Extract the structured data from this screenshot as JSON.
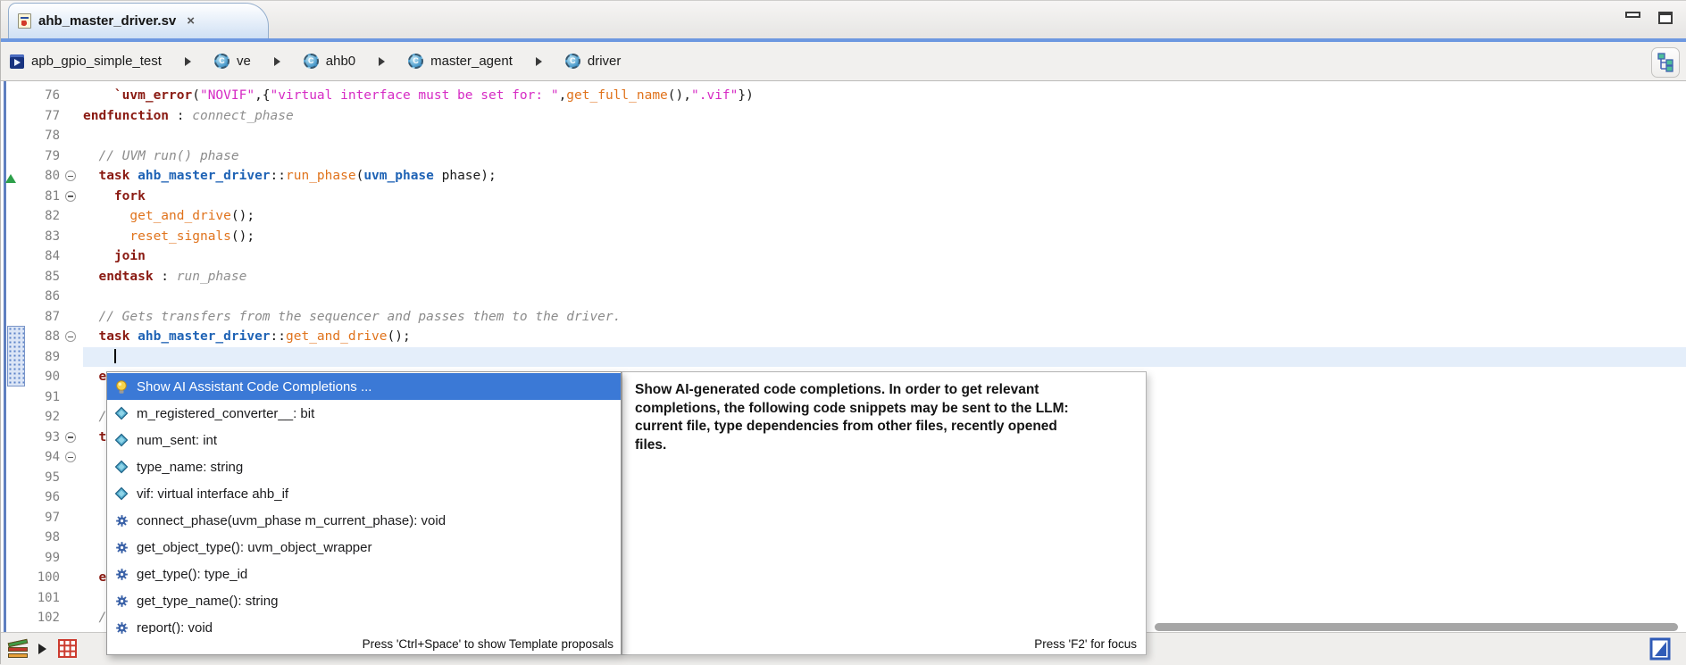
{
  "colors": {
    "accent_line": "#6d98e0",
    "selection_blue": "#3b79d6",
    "keyword": "#8a1a12",
    "type": "#1f63b5",
    "function": "#e0731c",
    "string": "#d62bc4",
    "comment": "#8b8b8b",
    "current_line": "#e4eefa"
  },
  "tab": {
    "title": "ahb_master_driver.sv",
    "close_label": "×"
  },
  "breadcrumb": {
    "items": [
      "apb_gpio_simple_test",
      "ve",
      "ahb0",
      "master_agent",
      "driver"
    ]
  },
  "editor": {
    "lines": [
      {
        "num": "76",
        "segs": [
          [
            "p",
            "    "
          ],
          [
            "k",
            "`uvm_error"
          ],
          [
            "p",
            "("
          ],
          [
            "s",
            "\"NOVIF\""
          ],
          [
            "p",
            ",{"
          ],
          [
            "s",
            "\"virtual interface must be set for: \""
          ],
          [
            "p",
            ","
          ],
          [
            "f",
            "get_full_name"
          ],
          [
            "p",
            "(),"
          ],
          [
            "s",
            "\".vif\""
          ],
          [
            "p",
            "})"
          ]
        ]
      },
      {
        "num": "77",
        "segs": [
          [
            "k",
            "endfunction"
          ],
          [
            "p",
            " : "
          ],
          [
            "l",
            "connect_phase"
          ]
        ]
      },
      {
        "num": "78",
        "segs": []
      },
      {
        "num": "79",
        "segs": [
          [
            "p",
            "  "
          ],
          [
            "c",
            "// UVM run() phase"
          ]
        ]
      },
      {
        "num": "80",
        "fold": true,
        "segs": [
          [
            "p",
            "  "
          ],
          [
            "k",
            "task"
          ],
          [
            "p",
            " "
          ],
          [
            "t",
            "ahb_master_driver"
          ],
          [
            "p",
            "::"
          ],
          [
            "f",
            "run_phase"
          ],
          [
            "p",
            "("
          ],
          [
            "t",
            "uvm_phase"
          ],
          [
            "p",
            " phase);"
          ]
        ]
      },
      {
        "num": "81",
        "fold": true,
        "segs": [
          [
            "p",
            "    "
          ],
          [
            "k",
            "fork"
          ]
        ]
      },
      {
        "num": "82",
        "segs": [
          [
            "p",
            "      "
          ],
          [
            "f",
            "get_and_drive"
          ],
          [
            "p",
            "();"
          ]
        ]
      },
      {
        "num": "83",
        "segs": [
          [
            "p",
            "      "
          ],
          [
            "f",
            "reset_signals"
          ],
          [
            "p",
            "();"
          ]
        ]
      },
      {
        "num": "84",
        "segs": [
          [
            "p",
            "    "
          ],
          [
            "k",
            "join"
          ]
        ]
      },
      {
        "num": "85",
        "segs": [
          [
            "p",
            "  "
          ],
          [
            "k",
            "endtask"
          ],
          [
            "p",
            " : "
          ],
          [
            "l",
            "run_phase"
          ]
        ]
      },
      {
        "num": "86",
        "segs": []
      },
      {
        "num": "87",
        "segs": [
          [
            "p",
            "  "
          ],
          [
            "c",
            "// Gets transfers from the sequencer and passes them to the driver."
          ]
        ]
      },
      {
        "num": "88",
        "fold": true,
        "segs": [
          [
            "p",
            "  "
          ],
          [
            "k",
            "task"
          ],
          [
            "p",
            " "
          ],
          [
            "t",
            "ahb_master_driver"
          ],
          [
            "p",
            "::"
          ],
          [
            "f",
            "get_and_drive"
          ],
          [
            "p",
            "();"
          ]
        ]
      },
      {
        "num": "89",
        "current": true,
        "caret": true,
        "segs": [
          [
            "p",
            "    "
          ]
        ]
      },
      {
        "num": "90",
        "segs": [
          [
            "p",
            "  "
          ],
          [
            "k",
            "en"
          ]
        ]
      },
      {
        "num": "91",
        "segs": []
      },
      {
        "num": "92",
        "segs": [
          [
            "p",
            "  "
          ],
          [
            "c",
            "//"
          ]
        ]
      },
      {
        "num": "93",
        "fold": true,
        "segs": [
          [
            "p",
            "  "
          ],
          [
            "k",
            "ta"
          ]
        ]
      },
      {
        "num": "94",
        "fold": true,
        "segs": []
      },
      {
        "num": "95",
        "segs": []
      },
      {
        "num": "96",
        "segs": []
      },
      {
        "num": "97",
        "segs": []
      },
      {
        "num": "98",
        "segs": []
      },
      {
        "num": "99",
        "segs": []
      },
      {
        "num": "100",
        "segs": [
          [
            "p",
            "  "
          ],
          [
            "k",
            "en"
          ]
        ]
      },
      {
        "num": "101",
        "segs": []
      },
      {
        "num": "102",
        "segs": [
          [
            "p",
            "  "
          ],
          [
            "c",
            "//"
          ]
        ]
      }
    ]
  },
  "completion_popup": {
    "items": [
      {
        "icon": "bulb-icon",
        "label": "Show AI Assistant Code Completions ...",
        "selected": true
      },
      {
        "icon": "field-icon",
        "label": "m_registered_converter__: bit",
        "selected": false
      },
      {
        "icon": "field-icon",
        "label": "num_sent: int",
        "selected": false
      },
      {
        "icon": "field-icon",
        "label": "type_name: string",
        "selected": false
      },
      {
        "icon": "field-icon",
        "label": "vif: virtual interface ahb_if",
        "selected": false
      },
      {
        "icon": "method-icon",
        "label": "connect_phase(uvm_phase m_current_phase): void",
        "selected": false
      },
      {
        "icon": "method-icon",
        "label": "get_object_type(): uvm_object_wrapper",
        "selected": false
      },
      {
        "icon": "method-icon",
        "label": "get_type(): type_id",
        "selected": false
      },
      {
        "icon": "method-icon",
        "label": "get_type_name(): string",
        "selected": false
      },
      {
        "icon": "method-icon",
        "label": "report(): void",
        "selected": false
      }
    ],
    "footer": "Press 'Ctrl+Space' to show Template proposals"
  },
  "doc_panel": {
    "text": "Show AI-generated code completions. In order to get relevant completions, the following code snippets may be sent to the LLM: current file, type dependencies from other files, recently opened files.",
    "footer": "Press 'F2' for focus"
  }
}
